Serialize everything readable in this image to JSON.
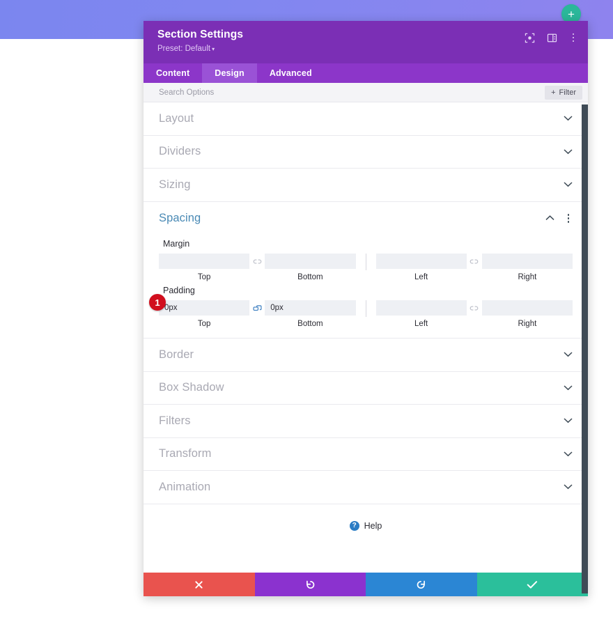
{
  "page": {
    "fab_label": "+"
  },
  "modal": {
    "title": "Section Settings",
    "preset_label": "Preset: Default",
    "preset_caret": "▾",
    "header_icons": [
      {
        "name": "focus-icon"
      },
      {
        "name": "panel-layout-icon"
      },
      {
        "name": "more-options-icon"
      }
    ],
    "tabs": [
      {
        "label": "Content",
        "active": false
      },
      {
        "label": "Design",
        "active": true
      },
      {
        "label": "Advanced",
        "active": false
      }
    ],
    "search": {
      "placeholder": "Search Options",
      "value": ""
    },
    "filter": {
      "plus": "+",
      "label": "Filter"
    },
    "sections_above": [
      {
        "label": "Layout"
      },
      {
        "label": "Dividers"
      },
      {
        "label": "Sizing"
      }
    ],
    "spacing": {
      "title": "Spacing",
      "margin": {
        "title": "Margin",
        "link_state": "unlinked",
        "fields": [
          {
            "sub": "Top",
            "value": "",
            "placeholder": ""
          },
          {
            "sub": "Bottom",
            "value": "",
            "placeholder": ""
          },
          {
            "sub": "Left",
            "value": "",
            "placeholder": ""
          },
          {
            "sub": "Right",
            "value": "",
            "placeholder": ""
          }
        ]
      },
      "padding": {
        "title": "Padding",
        "badge": "1",
        "link_state_left": "linked",
        "link_state_right": "unlinked",
        "fields": [
          {
            "sub": "Top",
            "value": "0px",
            "placeholder": ""
          },
          {
            "sub": "Bottom",
            "value": "0px",
            "placeholder": ""
          },
          {
            "sub": "Left",
            "value": "",
            "placeholder": ""
          },
          {
            "sub": "Right",
            "value": "",
            "placeholder": ""
          }
        ]
      }
    },
    "sections_below": [
      {
        "label": "Border"
      },
      {
        "label": "Box Shadow"
      },
      {
        "label": "Filters"
      },
      {
        "label": "Transform"
      },
      {
        "label": "Animation"
      }
    ],
    "help": {
      "icon_label": "?",
      "label": "Help"
    },
    "footer_buttons": [
      {
        "name": "cancel-button",
        "glyph": "✖",
        "color": "#e9534e"
      },
      {
        "name": "undo-button",
        "glyph": "↺",
        "color": "#8b32cf"
      },
      {
        "name": "redo-button",
        "glyph": "↻",
        "color": "#2b86d4"
      },
      {
        "name": "save-button",
        "glyph": "✔",
        "color": "#2bbf9b"
      }
    ]
  },
  "colors": {
    "header_purple": "#7b2fb5",
    "tabs_purple": "#8c36c9",
    "tab_active": "#9a52d6",
    "accent_blue": "#4a8ab5",
    "badge_red": "#d10f1e",
    "fab_green": "#2bb79a"
  }
}
